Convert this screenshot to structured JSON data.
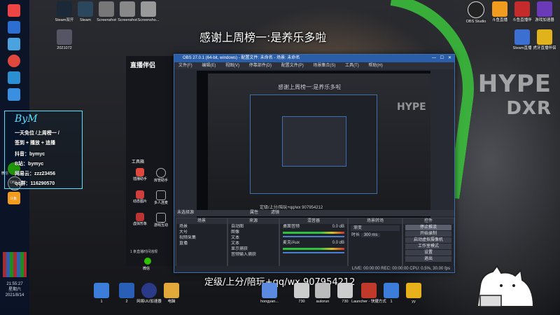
{
  "wallpaper": {
    "brand_text": "HYPE",
    "brand_text2": "DXR"
  },
  "banners": {
    "top": "感谢上周榜一:是养乐多啦",
    "bottom": "定级/上分/陪玩+qq/wx 907954212"
  },
  "infobox": {
    "title": "ByM",
    "lines": [
      "一天免位 /上周榜一 /",
      "签到 + 播放 + 追播",
      "抖音：bymyc",
      "B站：bymyc",
      "网易云：zzz23456",
      "qq群：116290570"
    ]
  },
  "desktop_icons_top": [
    "Steam双开",
    "Steam",
    "Screenshot",
    "Screenshot",
    "Screensho...",
    "2021072"
  ],
  "desktop_icons_right": [
    "OBS Studio",
    "斗鱼直播",
    "斗鱼直播伴",
    "游戏加速器",
    "Steam直播",
    "虎牙直播伴侣"
  ],
  "desktop_icons_bottom": [
    "1",
    "2",
    "网易UU加速器",
    "电脑",
    "hongyan...",
    "730",
    "autorun",
    "730",
    "Launcher - 快捷方式",
    "1",
    "yy"
  ],
  "taskbar": {
    "left_labels": [
      "微信",
      "OBS 2",
      "斗鱼"
    ],
    "time": "21:55:27",
    "weekday": "星期六",
    "date": "2021/8/14"
  },
  "streamer_app": {
    "logo": "直播伴侣",
    "tool_label": "工具箱",
    "items": [
      "插播助手",
      "房管助手",
      "动态图片",
      "多人连麦",
      "虚拟形象",
      "游戏互动"
    ],
    "notice": "1 条直播时间违规",
    "wechat": "微信"
  },
  "obs": {
    "title": "OBS 27.0.1 (64-bit, windows) - 配置文件: 未命名 - 场景: 未命名",
    "menu": [
      "文件(F)",
      "编辑(E)",
      "视图(V)",
      "停靠部件(D)",
      "配置文件(P)",
      "场景集合(S)",
      "工具(T)",
      "帮助(H)"
    ],
    "no_source": "未选择源",
    "prop_btn": "属性",
    "filter_btn": "滤镜",
    "docks": {
      "scenes": {
        "title": "场景",
        "items": [
          "场景",
          "大号",
          "视频采集",
          "直播"
        ]
      },
      "sources": {
        "title": "来源",
        "items": [
          "自动图",
          "图像",
          "文本",
          "文本",
          "显示捕获",
          "音频输入捕获"
        ]
      },
      "mixer": {
        "title": "混音器",
        "items": [
          "桌面音频",
          "麦克/Aux"
        ],
        "levels": [
          "0.0 dB",
          "0.0 dB"
        ]
      },
      "transitions": {
        "title": "场景转场",
        "type": "渐变",
        "duration_label": "时长",
        "duration": "300 ms"
      },
      "controls": {
        "title": "控件",
        "buttons": [
          "停止推流",
          "开始录制",
          "启动虚拟摄像机",
          "工作室模式",
          "设置",
          "退出"
        ]
      }
    },
    "status": "LIVE: 00:00:00    REC: 00:00:00    CPU: 0.5%, 30.00 fps"
  }
}
